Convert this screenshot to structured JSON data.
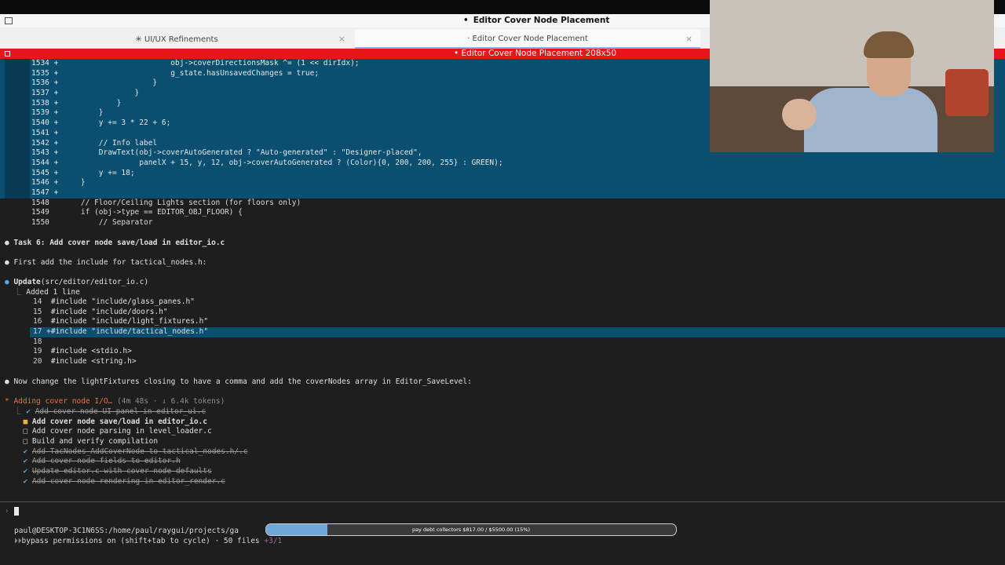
{
  "window": {
    "title": "Editor Cover Node Placement",
    "title_dot": "•"
  },
  "tabs": [
    {
      "label": "✳ UI/UX Refinements",
      "close": "×"
    },
    {
      "label": "· Editor Cover Node Placement",
      "close": "×"
    }
  ],
  "terminal": {
    "title": "Editor Cover Node Placement 208x50",
    "title_dot": "•",
    "diff_lines": [
      {
        "num": "1534",
        "sign": "+",
        "code": "                        obj->coverDirectionsMask ^= (1 << dirIdx);",
        "type": "add"
      },
      {
        "num": "1535",
        "sign": "+",
        "code": "                        g_state.hasUnsavedChanges = true;",
        "type": "add"
      },
      {
        "num": "1536",
        "sign": "+",
        "code": "                    }",
        "type": "add"
      },
      {
        "num": "1537",
        "sign": "+",
        "code": "                }",
        "type": "add"
      },
      {
        "num": "1538",
        "sign": "+",
        "code": "            }",
        "type": "add"
      },
      {
        "num": "1539",
        "sign": "+",
        "code": "        }",
        "type": "add"
      },
      {
        "num": "1540",
        "sign": "+",
        "code": "        y += 3 * 22 + 6;",
        "type": "add"
      },
      {
        "num": "1541",
        "sign": "+",
        "code": "",
        "type": "add"
      },
      {
        "num": "1542",
        "sign": "+",
        "code": "        // Info label",
        "type": "add"
      },
      {
        "num": "1543",
        "sign": "+",
        "code": "        DrawText(obj->coverAutoGenerated ? \"Auto-generated\" : \"Designer-placed\",",
        "type": "add"
      },
      {
        "num": "1544",
        "sign": "+",
        "code": "                 panelX + 15, y, 12, obj->coverAutoGenerated ? (Color){0, 200, 200, 255} : GREEN);",
        "type": "add"
      },
      {
        "num": "1545",
        "sign": "+",
        "code": "        y += 18;",
        "type": "add"
      },
      {
        "num": "1546",
        "sign": "+",
        "code": "    }",
        "type": "add"
      },
      {
        "num": "1547",
        "sign": "+",
        "code": "",
        "type": "add"
      },
      {
        "num": "1548",
        "sign": " ",
        "code": "    // Floor/Ceiling Lights section (for floors only)",
        "type": "ctx"
      },
      {
        "num": "1549",
        "sign": " ",
        "code": "    if (obj->type == EDITOR_OBJ_FLOOR) {",
        "type": "ctx"
      },
      {
        "num": "1550",
        "sign": " ",
        "code": "        // Separator",
        "type": "ctx"
      }
    ],
    "task6": "Task 6: Add cover node save/load in editor_io.c",
    "first_add": "First add the include for tactical_nodes.h:",
    "update_tool": "Update",
    "update_path": "(src/editor/editor_io.c)",
    "added_summary": "Added 1 line",
    "include_lines": [
      {
        "num": "14",
        "text": "  #include \"include/glass_panes.h\""
      },
      {
        "num": "15",
        "text": "  #include \"include/doors.h\""
      },
      {
        "num": "16",
        "text": "  #include \"include/light_fixtures.h\""
      },
      {
        "num": "17",
        "text": " +#include \"include/tactical_nodes.h\""
      },
      {
        "num": "18",
        "text": ""
      },
      {
        "num": "19",
        "text": "  #include <stdio.h>"
      },
      {
        "num": "20",
        "text": "  #include <string.h>"
      }
    ],
    "now_change": "Now change the lightFixtures closing to have a comma and add the coverNodes array in Editor_SaveLevel:",
    "status_label": "Adding cover node I/O…",
    "status_meta": "(4m 48s · ↓ 6.4k tokens)",
    "todos": [
      {
        "mark": "✔",
        "text": "Add cover node UI panel in editor_ui.c",
        "state": "done"
      },
      {
        "mark": "■",
        "text": "Add cover node save/load in editor_io.c",
        "state": "active"
      },
      {
        "mark": "□",
        "text": "Add cover node parsing in level_loader.c",
        "state": "pending"
      },
      {
        "mark": "□",
        "text": "Build and verify compilation",
        "state": "pending"
      },
      {
        "mark": "✔",
        "text": "Add TacNodes_AddCoverNode to tactical_nodes.h/.c",
        "state": "done"
      },
      {
        "mark": "✔",
        "text": "Add cover node fields to editor.h",
        "state": "done"
      },
      {
        "mark": "✔",
        "text": "Update editor.c with cover node defaults",
        "state": "done"
      },
      {
        "mark": "✔",
        "text": "Add cover node rendering in editor_render.c",
        "state": "done"
      }
    ],
    "prompt_char": "›",
    "path_line": "paul@DESKTOP-3C1N6SS:/home/paul/raygui/projects/ga",
    "bypass_line": "bypass permissions on (shift+tab to cycle) · 50 files ",
    "diff_stat": "+3/1"
  },
  "progress": {
    "label": "pay debt collectors $817.00 / $5500.00 (15%)",
    "fraction": 0.15,
    "fill_color": "#6fa7d6"
  },
  "colors": {
    "diff_add_bg": "#0a4f70",
    "title_bar_red": "#e8151b",
    "accent_blue": "#55a7e6",
    "accent_orange": "#e07548"
  }
}
